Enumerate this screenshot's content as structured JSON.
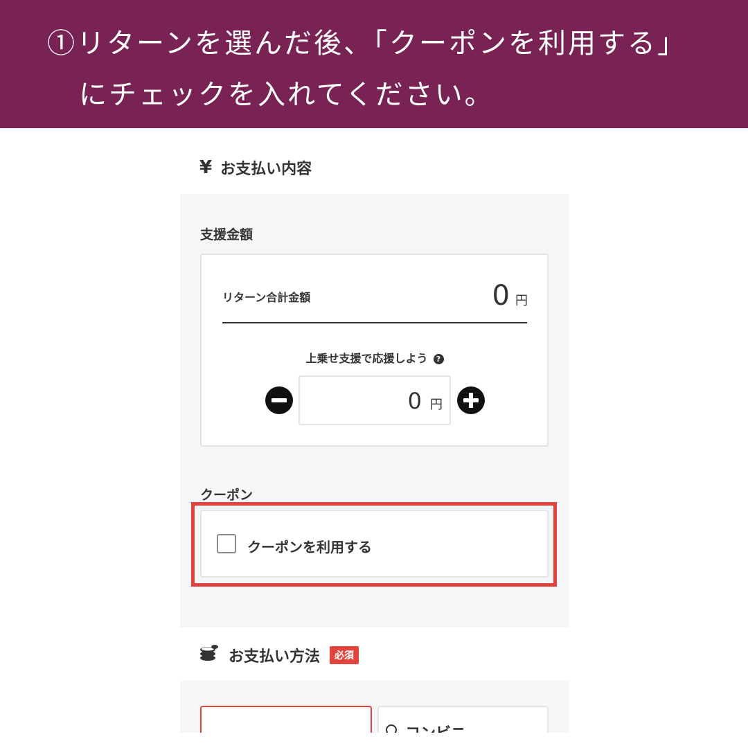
{
  "banner": {
    "line1": "①リターンを選んだ後、「クーポンを利用する」",
    "line2": "にチェックを入れてください。"
  },
  "payment_details": {
    "icon": "yen-icon",
    "icon_glyph": "¥",
    "title": "お支払い内容"
  },
  "support_amount": {
    "label": "支援金額",
    "return_total_label": "リターン合計金額",
    "return_total_value": "0",
    "currency_unit": "円",
    "extra_support_label": "上乗せ支援で応援しよう",
    "help_glyph": "?",
    "extra_support_value": "0"
  },
  "coupon": {
    "label": "クーポン",
    "checkbox_label": "クーポンを利用する",
    "checked": false
  },
  "payment_method": {
    "icon": "coins-icon",
    "title": "お支払い方法",
    "required_badge": "必須",
    "options": [
      {
        "label": "",
        "selected": true
      },
      {
        "label": "コンビニ",
        "selected": false
      }
    ]
  },
  "colors": {
    "banner_bg": "#782354",
    "highlight": "#e0443c",
    "panel_bg": "#f5f6f7",
    "required_badge": "#e0443c"
  }
}
